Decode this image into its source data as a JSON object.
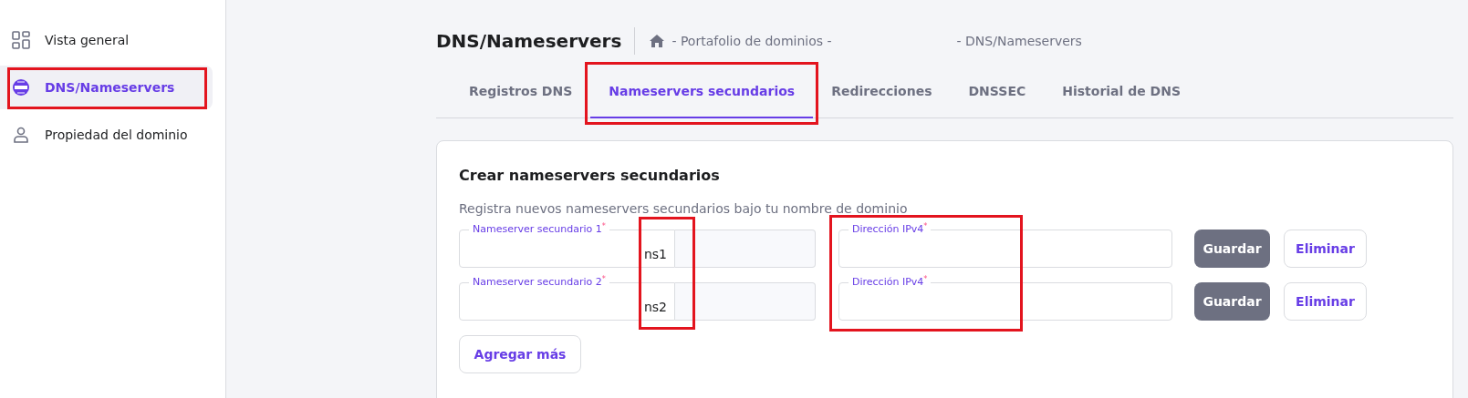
{
  "sidebar": {
    "items": [
      {
        "label": "Vista general",
        "selected": false,
        "highlighted": false
      },
      {
        "label": "DNS/Nameservers",
        "selected": true,
        "highlighted": true
      },
      {
        "label": "Propiedad del dominio",
        "selected": false,
        "highlighted": false
      }
    ]
  },
  "header": {
    "title": "DNS/Nameservers",
    "breadcrumb": [
      "- Portafolio de dominios -",
      "- DNS/Nameservers"
    ]
  },
  "tabs": [
    {
      "label": "Registros DNS",
      "selected": false,
      "highlighted": false
    },
    {
      "label": "Nameservers secundarios",
      "selected": true,
      "highlighted": true
    },
    {
      "label": "Redirecciones",
      "selected": false,
      "highlighted": false
    },
    {
      "label": "DNSSEC",
      "selected": false,
      "highlighted": false
    },
    {
      "label": "Historial de DNS",
      "selected": false,
      "highlighted": false
    }
  ],
  "card": {
    "title": "Crear nameservers secundarios",
    "subtitle": "Registra nuevos nameservers secundarios bajo tu nombre de dominio",
    "rows": [
      {
        "nameserver_label": "Nameserver secundario 1$^{*}$",
        "nameserver_value": "ns1",
        "ip_label": "Dirección IPv4$^{*}$",
        "save": "Guardar",
        "delete": "Eliminar"
      },
      {
        "nameserver_label": "Nameserver secundario 2$^{*}$",
        "nameserver_value": "ns2",
        "ip_label": "Dirección IPv4$^{*}$",
        "save": "Guardar",
        "delete": "Eliminar"
      }
    ],
    "add_button": "Agregar más",
    "nameserver_values_highlighted": true,
    "ip_fields_highlighted": true
  }
}
